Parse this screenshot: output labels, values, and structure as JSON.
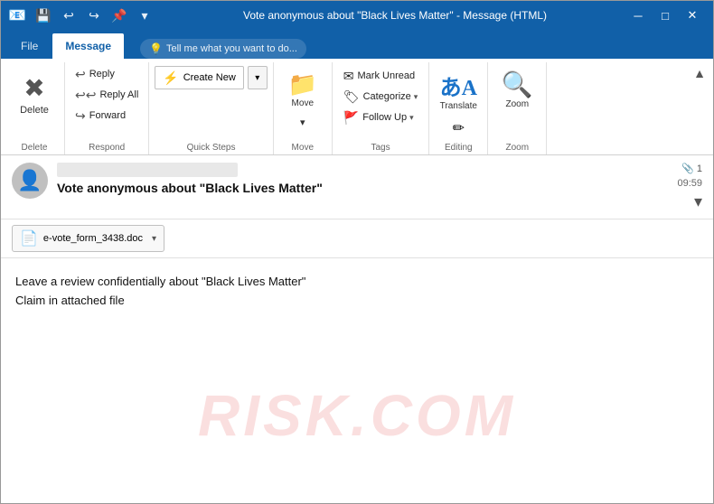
{
  "window": {
    "title": "Vote anonymous about \"Black Lives Matter\" - Message (HTML)",
    "icon": "📧"
  },
  "titlebar": {
    "save_btn": "💾",
    "undo_btn": "↩",
    "redo_btn": "↪",
    "pin_btn": "📌",
    "dropdown_btn": "▾",
    "minimize": "─",
    "restore": "□",
    "close": "✕"
  },
  "tabs": {
    "file_label": "File",
    "message_label": "Message",
    "tell_me_placeholder": "Tell me what you want to do..."
  },
  "ribbon": {
    "groups": {
      "delete": {
        "label": "Delete",
        "delete_btn": "Delete",
        "delete_icon": "✖"
      },
      "respond": {
        "label": "Respond",
        "reply_label": "Reply",
        "reply_all_label": "Reply All",
        "forward_label": "Forward"
      },
      "quick_steps": {
        "label": "Quick Steps",
        "create_new_label": "Create New",
        "more_label": "▾"
      },
      "move": {
        "label": "Move",
        "move_label": "Move",
        "move_icon": "📁",
        "dropdown": "▾"
      },
      "tags": {
        "label": "Tags",
        "mark_unread_label": "Mark Unread",
        "categorize_label": "Categorize",
        "follow_up_label": "Follow Up",
        "caret": "▾"
      },
      "editing": {
        "label": "Editing",
        "translate_label": "Translate",
        "translate_char1": "あ",
        "translate_char2": "A"
      },
      "zoom": {
        "label": "Zoom",
        "zoom_label": "Zoom"
      }
    }
  },
  "email": {
    "from_placeholder": "",
    "subject": "Vote anonymous about \"Black Lives Matter\"",
    "time": "09:59",
    "attachment_count": "1",
    "attachment_icon": "📎",
    "body_line1": "Leave a review confidentially about \"Black Lives Matter\"",
    "body_line2": "Claim in attached file",
    "attachment_filename": "e-vote_form_3438.doc"
  },
  "watermark": {
    "text": "RISK.COM"
  }
}
